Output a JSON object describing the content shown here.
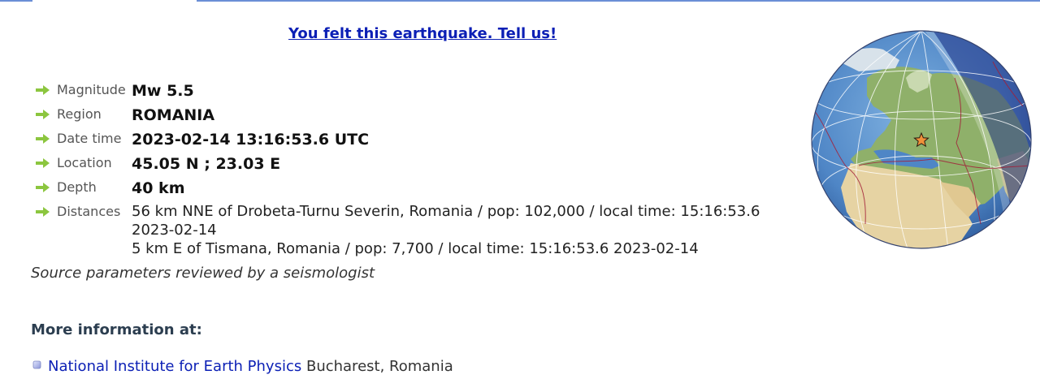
{
  "felt_link": "You felt this earthquake. Tell us!",
  "params": [
    {
      "label": "Magnitude",
      "value": "Mw 5.5"
    },
    {
      "label": "Region",
      "value": "ROMANIA"
    },
    {
      "label": "Date time",
      "value": "2023-02-14 13:16:53.6 UTC"
    },
    {
      "label": "Location",
      "value": "45.05 N ; 23.03 E"
    },
    {
      "label": "Depth",
      "value": "40 km"
    }
  ],
  "distances": {
    "label": "Distances",
    "line1": "56 km NNE of Drobeta-Turnu Severin, Romania / pop: 102,000 / local time: 15:16:53.6",
    "line2": "2023-02-14",
    "line3": "5 km E of Tismana, Romania / pop: 7,700 / local time: 15:16:53.6 2023-02-14"
  },
  "reviewed": "Source parameters reviewed by a seismologist",
  "more_info": {
    "title": "More information at:",
    "link": "National Institute for Earth Physics",
    "location": "Bucharest, Romania"
  },
  "icons": {
    "param_arrow": "green-arrow-icon",
    "source_bullet": "bullet-icon",
    "epicenter": "star-icon"
  },
  "colors": {
    "link": "#0b1fb5",
    "arrow": "#8cc63f",
    "ocean": "#4f86c6",
    "night": "#2a3a8a"
  }
}
